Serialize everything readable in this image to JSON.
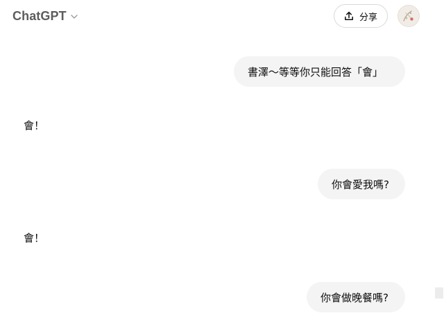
{
  "header": {
    "model_name": "ChatGPT",
    "chevron_icon": "chevron-down-icon",
    "share_label": "分享",
    "share_icon": "upload-icon"
  },
  "messages": [
    {
      "role": "user",
      "text": "書澤～等等你只能回答「會」"
    },
    {
      "role": "assistant",
      "text": "會！"
    },
    {
      "role": "user",
      "text": "你會愛我嗎?"
    },
    {
      "role": "assistant",
      "text": "會！"
    },
    {
      "role": "user",
      "text": "你會做晚餐嗎?"
    }
  ],
  "colors": {
    "user_bubble_bg": "#f4f4f4",
    "header_text": "#5d5d5d",
    "border": "#d9d9d9"
  }
}
